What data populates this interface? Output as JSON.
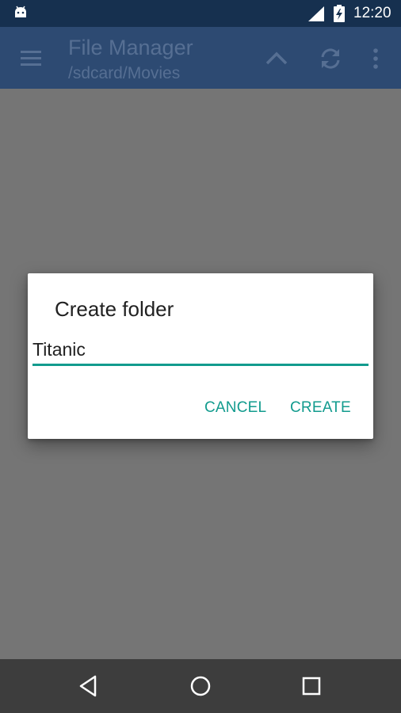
{
  "status_bar": {
    "time": "12:20",
    "icons": [
      "android-icon",
      "cell-signal-icon",
      "battery-charging-icon"
    ]
  },
  "app_bar": {
    "title": "File Manager",
    "path": "/sdcard/Movies",
    "icons": [
      "menu-icon",
      "navigate-up-icon",
      "refresh-icon",
      "more-vert-icon"
    ],
    "background": "#2d4a72"
  },
  "dialog": {
    "title": "Create folder",
    "input_value": "Titanic",
    "cancel_label": "CANCEL",
    "create_label": "CREATE",
    "accent_color": "#129b8e"
  },
  "nav_bar": {
    "icons": [
      "back-icon",
      "home-icon",
      "recent-apps-icon"
    ]
  }
}
